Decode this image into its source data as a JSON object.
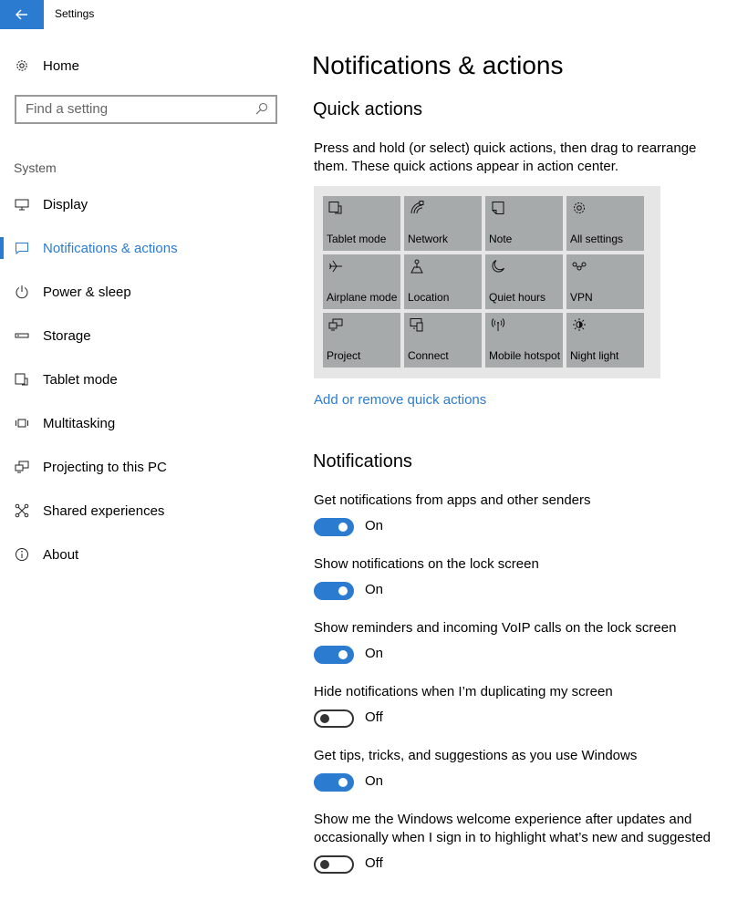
{
  "window": {
    "title": "Settings"
  },
  "sidebar": {
    "home_label": "Home",
    "search": {
      "placeholder": "Find a setting"
    },
    "group_label": "System",
    "items": [
      {
        "label": "Display",
        "icon": "display-icon"
      },
      {
        "label": "Notifications & actions",
        "icon": "notifications-icon",
        "active": true
      },
      {
        "label": "Power & sleep",
        "icon": "power-icon"
      },
      {
        "label": "Storage",
        "icon": "storage-icon"
      },
      {
        "label": "Tablet mode",
        "icon": "tablet-mode-icon"
      },
      {
        "label": "Multitasking",
        "icon": "multitasking-icon"
      },
      {
        "label": "Projecting to this PC",
        "icon": "projecting-icon"
      },
      {
        "label": "Shared experiences",
        "icon": "shared-experiences-icon"
      },
      {
        "label": "About",
        "icon": "info-icon"
      }
    ]
  },
  "main": {
    "page_title": "Notifications & actions",
    "quick_actions": {
      "title": "Quick actions",
      "description": "Press and hold (or select) quick actions, then drag to rearrange them. These quick actions appear in action center.",
      "tiles": [
        {
          "label": "Tablet mode",
          "icon": "tablet-mode-icon"
        },
        {
          "label": "Network",
          "icon": "network-icon"
        },
        {
          "label": "Note",
          "icon": "note-icon"
        },
        {
          "label": "All settings",
          "icon": "gear-icon"
        },
        {
          "label": "Airplane mode",
          "icon": "airplane-icon"
        },
        {
          "label": "Location",
          "icon": "location-icon"
        },
        {
          "label": "Quiet hours",
          "icon": "moon-icon"
        },
        {
          "label": "VPN",
          "icon": "vpn-icon"
        },
        {
          "label": "Project",
          "icon": "project-icon"
        },
        {
          "label": "Connect",
          "icon": "connect-icon"
        },
        {
          "label": "Mobile hotspot",
          "icon": "hotspot-icon"
        },
        {
          "label": "Night light",
          "icon": "night-light-icon"
        }
      ],
      "link": "Add or remove quick actions"
    },
    "notifications": {
      "title": "Notifications",
      "settings": [
        {
          "label": "Get notifications from apps and other senders",
          "state": "On"
        },
        {
          "label": "Show notifications on the lock screen",
          "state": "On"
        },
        {
          "label": "Show reminders and incoming VoIP calls on the lock screen",
          "state": "On"
        },
        {
          "label": "Hide notifications when I’m duplicating my screen",
          "state": "Off"
        },
        {
          "label": "Get tips, tricks, and suggestions as you use Windows",
          "state": "On"
        },
        {
          "label": "Show me the Windows welcome experience after updates and occasionally when I sign in to highlight what’s new and suggested",
          "state": "Off"
        }
      ]
    }
  },
  "colors": {
    "accent": "#2b7bd1",
    "tile": "#a7aaab",
    "panel": "#e6e6e6"
  }
}
